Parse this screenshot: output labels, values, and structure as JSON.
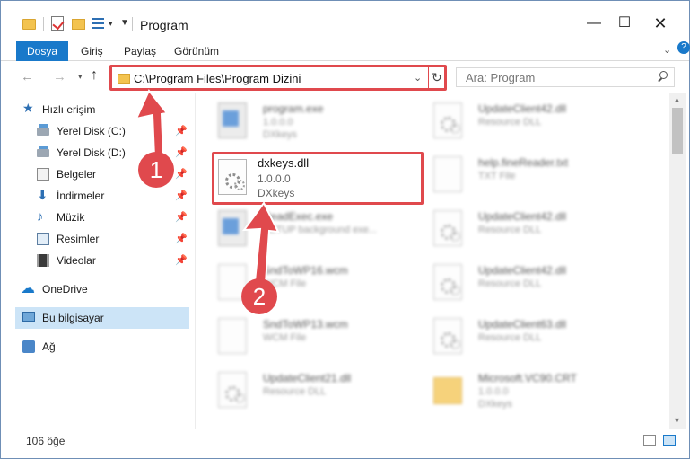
{
  "window": {
    "title": "Program",
    "controls": {
      "minimize": "—",
      "maximize": "☐",
      "close": "✕"
    }
  },
  "ribbon": {
    "tabs": [
      {
        "label": "Dosya"
      },
      {
        "label": "Giriş"
      },
      {
        "label": "Paylaş"
      },
      {
        "label": "Görünüm"
      }
    ]
  },
  "address": {
    "path": "C:\\Program Files\\Program Dizini",
    "search_placeholder": "Ara: Program"
  },
  "sidebar": {
    "items": [
      {
        "label": "Hızlı erişim",
        "icon": "star-icon"
      },
      {
        "label": "Yerel Disk (C:)",
        "icon": "drive-icon"
      },
      {
        "label": "Yerel Disk (D:)",
        "icon": "drive-icon"
      },
      {
        "label": "Belgeler",
        "icon": "document-icon"
      },
      {
        "label": "İndirmeler",
        "icon": "download-icon"
      },
      {
        "label": "Müzik",
        "icon": "music-icon"
      },
      {
        "label": "Resimler",
        "icon": "pictures-icon"
      },
      {
        "label": "Videolar",
        "icon": "video-icon"
      },
      {
        "label": "OneDrive",
        "icon": "cloud-icon"
      },
      {
        "label": "Bu bilgisayar",
        "icon": "computer-icon"
      },
      {
        "label": "Ağ",
        "icon": "network-icon"
      }
    ]
  },
  "files": {
    "left": [
      {
        "name": "program.exe",
        "line1": "1.0.0.0",
        "line2": "DXkeys"
      },
      {
        "name": "dxkeys.dll",
        "line1": "1.0.0.0",
        "line2": "DXkeys"
      },
      {
        "name": "ReadExec.exe",
        "line1": "SETUP background exe...",
        "line2": ""
      },
      {
        "name": "SndToWP16.wcm",
        "line1": "WCM File",
        "line2": ""
      },
      {
        "name": "SndToWP13.wcm",
        "line1": "WCM File",
        "line2": ""
      },
      {
        "name": "UpdateClient21.dll",
        "line1": "Resource DLL",
        "line2": ""
      }
    ],
    "right": [
      {
        "name": "UpdateClient42.dll",
        "line1": "Resource DLL",
        "line2": ""
      },
      {
        "name": "help.fineReader.txt",
        "line1": "TXT File",
        "line2": ""
      },
      {
        "name": "UpdateClient42.dll",
        "line1": "Resource DLL",
        "line2": ""
      },
      {
        "name": "UpdateClient42.dll",
        "line1": "Resource DLL",
        "line2": ""
      },
      {
        "name": "UpdateClient63.dll",
        "line1": "Resource DLL",
        "line2": ""
      },
      {
        "name": "Microsoft.VC90.CRT",
        "line1": "1.0.0.0",
        "line2": "DXkeys"
      }
    ]
  },
  "annotations": {
    "step1": "1",
    "step2": "2"
  },
  "status": {
    "count": "106 öğe"
  },
  "colors": {
    "accent": "#1979ca",
    "highlight": "#e0494d"
  }
}
